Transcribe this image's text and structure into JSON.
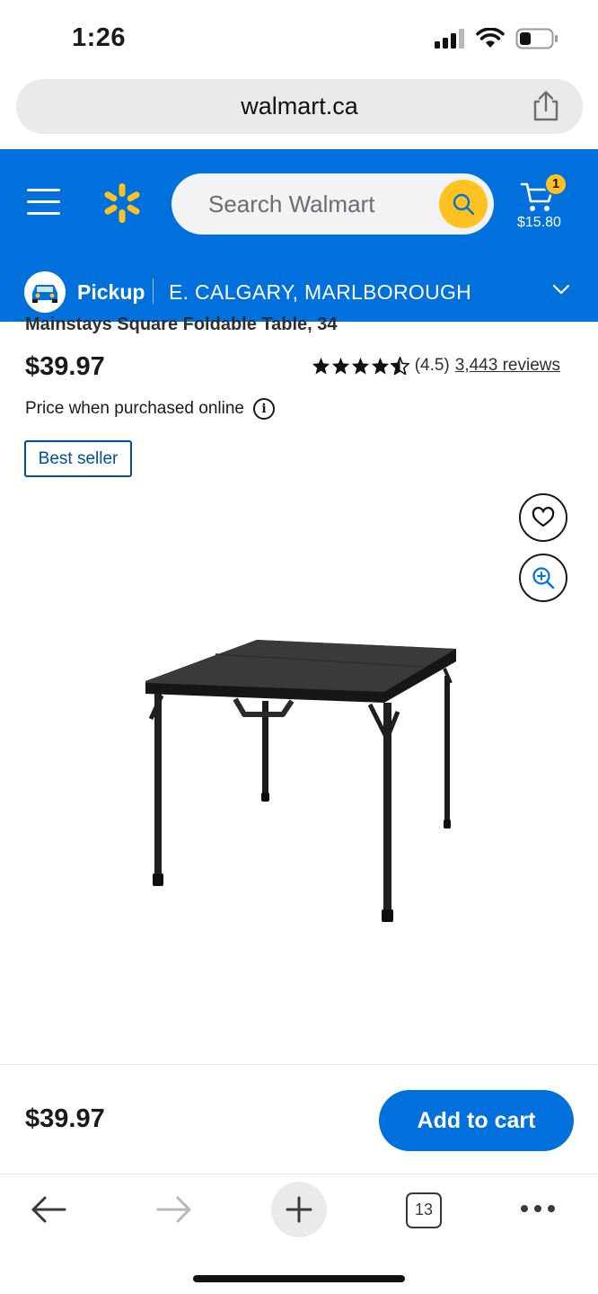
{
  "status_bar": {
    "time": "1:26"
  },
  "browser": {
    "url": "walmart.ca",
    "tab_count": "13"
  },
  "header": {
    "search_placeholder": "Search Walmart",
    "cart_count": "1",
    "cart_total": "$15.80",
    "pickup_label": "Pickup",
    "pickup_location": "E. CALGARY, MARLBOROUGH",
    "brand_color": "#0071dc",
    "accent_color": "#ffc220"
  },
  "product": {
    "title": "Mainstays Square Foldable Table, 34",
    "price": "$39.97",
    "rating_stars": 4.5,
    "rating_value": "(4.5)",
    "review_count": "3,443 reviews",
    "price_note": "Price when purchased online",
    "badge": "Best seller",
    "image_icon": "folding-table-image"
  },
  "sticky": {
    "price": "$39.97",
    "add_to_cart": "Add to cart"
  }
}
